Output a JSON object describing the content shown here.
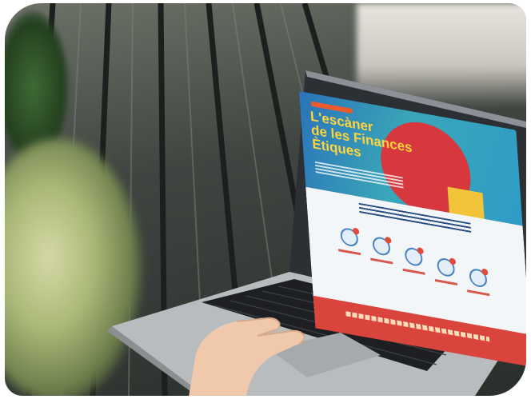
{
  "photo": {
    "subject": "laptop-on-wooden-table"
  },
  "screen": {
    "hero_title_line1": "L'escàner",
    "hero_title_line2": "de les Finances",
    "hero_title_line3": "Ètiques",
    "colors": {
      "hero_blue": "#2a73b8",
      "accent_red": "#d9453c",
      "accent_yellow": "#f2c43a",
      "title_yellow": "#ffd43b"
    }
  }
}
